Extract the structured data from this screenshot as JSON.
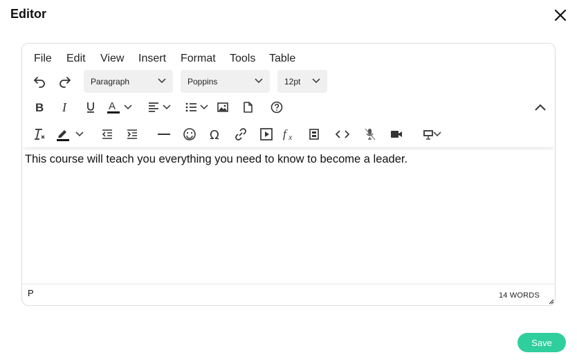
{
  "dialog": {
    "title": "Editor",
    "save_label": "Save"
  },
  "menu": [
    "File",
    "Edit",
    "View",
    "Insert",
    "Format",
    "Tools",
    "Table"
  ],
  "selects": {
    "block": "Paragraph",
    "font": "Poppins",
    "size": "12pt"
  },
  "content": {
    "text": "This course will teach you everything you need to know to become a leader."
  },
  "status": {
    "path": "P",
    "word_count": "14 WORDS"
  },
  "colors": {
    "accent": "#2fcf9d",
    "text_color_bar": "#111111",
    "highlight_bar": "#111111"
  }
}
